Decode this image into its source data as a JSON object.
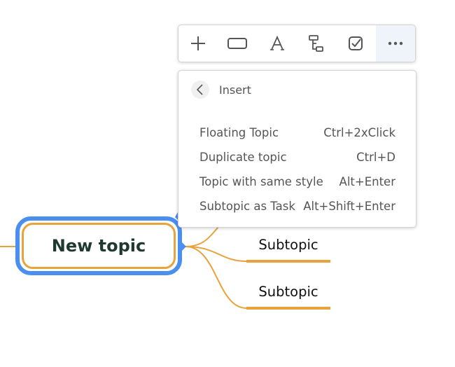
{
  "toolbar": {
    "buttons": [
      {
        "name": "add-icon",
        "label": "Add"
      },
      {
        "name": "shape-icon",
        "label": "Shape"
      },
      {
        "name": "text-style-icon",
        "label": "Text"
      },
      {
        "name": "structure-icon",
        "label": "Structure"
      },
      {
        "name": "task-checkbox-icon",
        "label": "Task"
      },
      {
        "name": "more-icon",
        "label": "More",
        "active": true
      }
    ]
  },
  "menu": {
    "title": "Insert",
    "items": [
      {
        "label": "Floating Topic",
        "shortcut": "Ctrl+2xClick"
      },
      {
        "label": "Duplicate topic",
        "shortcut": "Ctrl+D"
      },
      {
        "label": "Topic with same style",
        "shortcut": "Alt+Enter"
      },
      {
        "label": "Subtopic as Task",
        "shortcut": "Alt+Shift+Enter"
      }
    ]
  },
  "mindmap": {
    "central_topic": "New topic",
    "subtopics": [
      "Subtopic",
      "Subtopic"
    ]
  },
  "colors": {
    "selection": "#4a8ef0",
    "branch": "#e8a33d",
    "topic_text": "#1e3a2f",
    "menu_text": "#555555"
  }
}
